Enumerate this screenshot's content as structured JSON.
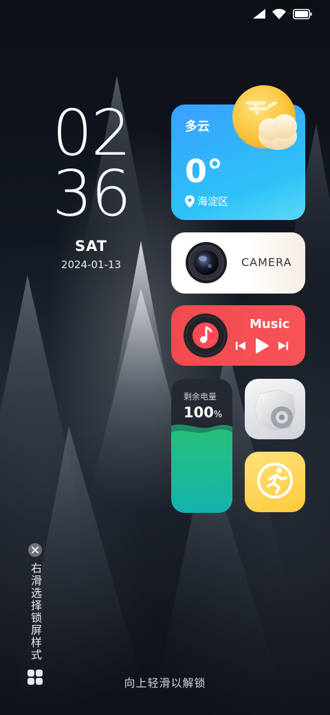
{
  "status_bar": {
    "icons": [
      "signal-icon",
      "wifi-icon",
      "battery-icon"
    ]
  },
  "clock": {
    "hours": "02",
    "minutes": "36",
    "day": "SAT",
    "date": "2024-01-13"
  },
  "weather": {
    "condition": "多云",
    "temperature": "0°",
    "location": "海淀区",
    "icon": "partly-cloudy-icon",
    "colors": {
      "start": "#3aa0ff",
      "end": "#5ad8f7"
    }
  },
  "camera": {
    "label": "CAMERA",
    "icon": "camera-lens-icon"
  },
  "music": {
    "title": "Music",
    "icon": "music-note-icon",
    "controls": [
      "previous-icon",
      "play-icon",
      "next-icon"
    ],
    "color": "#f24a4f"
  },
  "battery_widget": {
    "label": "剩余电量",
    "value": "100",
    "unit": "%",
    "level": 1.0
  },
  "apps": [
    {
      "name": "settings",
      "icon": "settings-gear-icon"
    },
    {
      "name": "fitness",
      "icon": "running-person-icon"
    }
  ],
  "side_panel": {
    "text": "右滑选择锁屏样式",
    "close_icon": "close-icon",
    "grid_icon": "grid-icon"
  },
  "unlock_hint": "向上轻滑以解锁"
}
